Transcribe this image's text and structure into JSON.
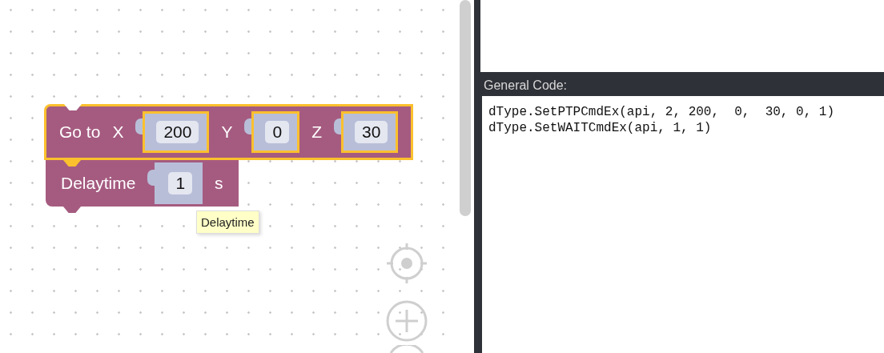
{
  "workspace": {
    "blocks": [
      {
        "kind": "move",
        "selected": true,
        "parts": [
          {
            "kind": "label",
            "text": "Go to"
          },
          {
            "kind": "label",
            "text": "X"
          },
          {
            "kind": "input",
            "value": "200"
          },
          {
            "kind": "label",
            "text": "Y"
          },
          {
            "kind": "input",
            "value": "0"
          },
          {
            "kind": "label",
            "text": "Z"
          },
          {
            "kind": "input",
            "value": "30"
          }
        ]
      },
      {
        "kind": "delay",
        "selected": false,
        "parts": [
          {
            "kind": "label",
            "text": "Delaytime"
          },
          {
            "kind": "input",
            "value": "1"
          },
          {
            "kind": "label",
            "text": "s"
          }
        ]
      }
    ],
    "tooltip": "Delaytime"
  },
  "code_panel": {
    "title": "General Code:",
    "lines": [
      "dType.SetPTPCmdEx(api, 2, 200,  0,  30, 0, 1)",
      "dType.SetWAITCmdEx(api, 1, 1)"
    ]
  }
}
